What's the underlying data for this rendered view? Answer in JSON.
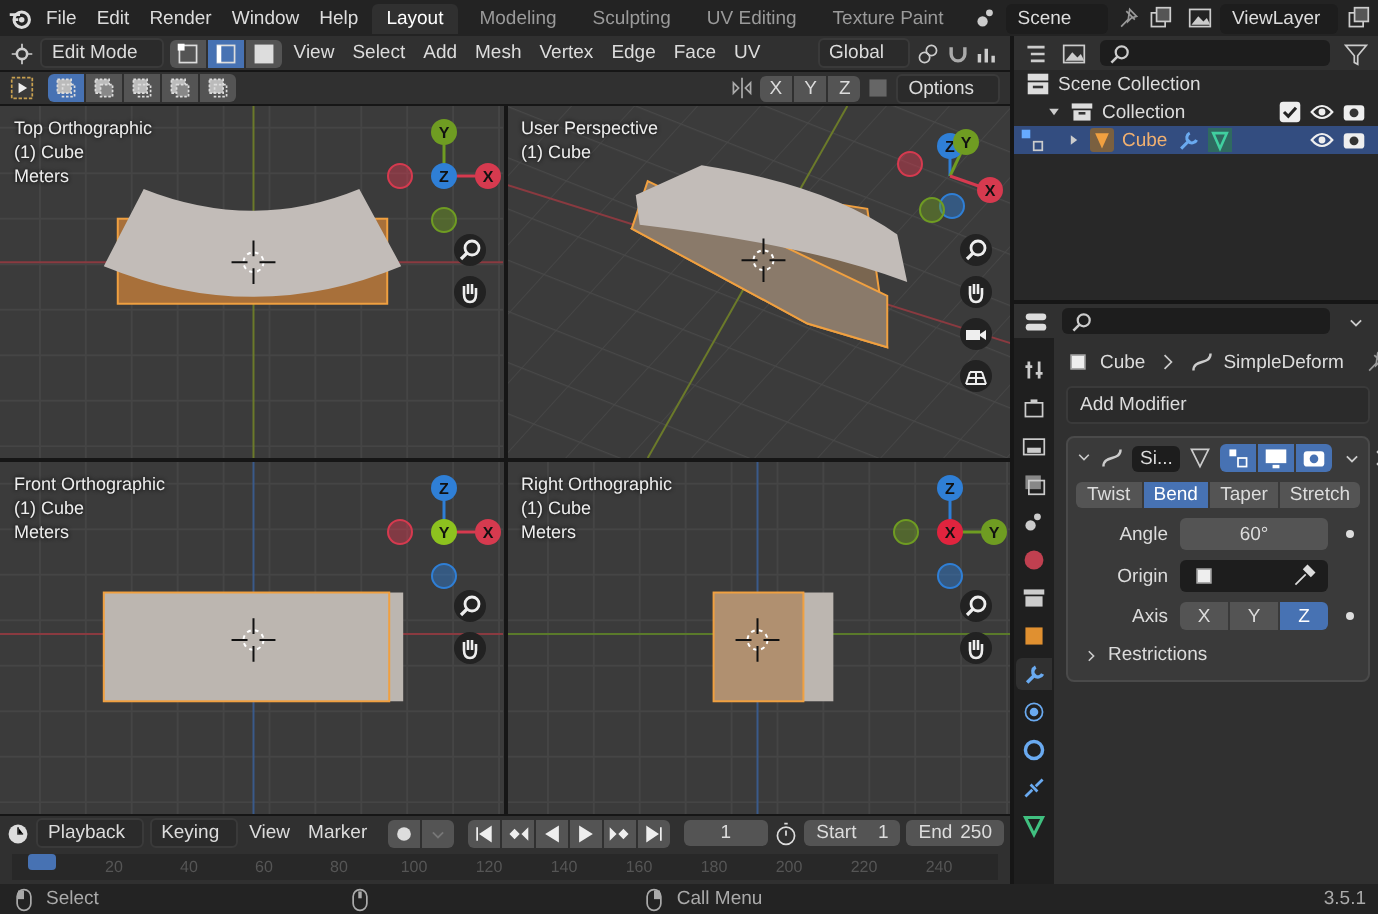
{
  "menus": [
    "File",
    "Edit",
    "Render",
    "Window",
    "Help"
  ],
  "workspaces": [
    {
      "label": "Layout",
      "selected": true
    },
    {
      "label": "Modeling",
      "selected": false
    },
    {
      "label": "Sculpting",
      "selected": false
    },
    {
      "label": "UV Editing",
      "selected": false
    },
    {
      "label": "Texture Paint",
      "selected": false
    }
  ],
  "scene": "Scene",
  "view_layer": "ViewLayer",
  "header": {
    "mode": "Edit Mode",
    "select_modes": [
      {
        "kind": "vertex",
        "selected": false
      },
      {
        "kind": "edge",
        "selected": true
      },
      {
        "kind": "face",
        "selected": false
      }
    ],
    "menus": [
      "View",
      "Select",
      "Add",
      "Mesh",
      "Vertex",
      "Edge",
      "Face",
      "UV"
    ],
    "orientation": "Global"
  },
  "tool_header": {
    "select_modes": [
      {
        "selected": true
      },
      {
        "selected": false
      },
      {
        "selected": false
      },
      {
        "selected": false
      },
      {
        "selected": false
      }
    ],
    "mirror": [
      {
        "label": "X",
        "selected": false
      },
      {
        "label": "Y",
        "selected": false
      },
      {
        "label": "Z",
        "selected": false
      }
    ],
    "options": "Options"
  },
  "viewports": [
    {
      "title": "Top Orthographic",
      "object": "(1) Cube",
      "units": "Meters",
      "gizmo": [
        {
          "label": "Y",
          "color": "#6f9c22"
        },
        {
          "label": "Z",
          "color": "#2f7fd6"
        },
        {
          "label": "X",
          "color": "#d63a4f"
        }
      ]
    },
    {
      "title": "User Perspective",
      "object": "(1) Cube",
      "gizmo": [
        {
          "label": "Z",
          "color": "#2f7fd6"
        },
        {
          "label": "Y",
          "color": "#6f9c22"
        },
        {
          "label": "X",
          "color": "#d63a4f"
        }
      ]
    },
    {
      "title": "Front Orthographic",
      "object": "(1) Cube",
      "units": "Meters",
      "gizmo": [
        {
          "label": "Z",
          "color": "#2f7fd6"
        },
        {
          "label": "Y",
          "color": "#8dc21f"
        },
        {
          "label": "X",
          "color": "#d63a4f"
        }
      ]
    },
    {
      "title": "Right Orthographic",
      "object": "(1) Cube",
      "units": "Meters",
      "gizmo": [
        {
          "label": "Z",
          "color": "#2f7fd6"
        },
        {
          "label": "X",
          "color": "#e0243e"
        },
        {
          "label": "Y",
          "color": "#6f9c22"
        }
      ]
    }
  ],
  "outliner": {
    "items": [
      {
        "kind": "scene_collection",
        "label": "Scene Collection",
        "children": [
          {
            "kind": "collection",
            "label": "Collection",
            "expanded": true,
            "checked": true,
            "children": [
              {
                "kind": "mesh",
                "label": "Cube",
                "expanded": false,
                "selected": true
              }
            ]
          }
        ]
      }
    ]
  },
  "properties": {
    "tabs": [
      {
        "kind": "tool",
        "selected": false
      },
      {
        "kind": "render",
        "selected": false
      },
      {
        "kind": "output",
        "selected": false
      },
      {
        "kind": "view_layer",
        "selected": false
      },
      {
        "kind": "scene",
        "selected": false
      },
      {
        "kind": "world",
        "selected": false
      },
      {
        "kind": "collection",
        "selected": false
      },
      {
        "kind": "object",
        "selected": false
      },
      {
        "kind": "modifier",
        "selected": true
      },
      {
        "kind": "particles",
        "selected": false
      },
      {
        "kind": "physics",
        "selected": false
      },
      {
        "kind": "constraints",
        "selected": false
      },
      {
        "kind": "data",
        "selected": false
      }
    ],
    "object": "Cube",
    "modifier": "SimpleDeform",
    "add_modifier": "Add Modifier",
    "panel": {
      "name": "Si...",
      "modes": [
        {
          "label": "Twist",
          "selected": false
        },
        {
          "label": "Bend",
          "selected": true
        },
        {
          "label": "Taper",
          "selected": false
        },
        {
          "label": "Stretch",
          "selected": false
        }
      ],
      "angle_label": "Angle",
      "angle": "60°",
      "origin_label": "Origin",
      "axis_label": "Axis",
      "axes": [
        {
          "label": "X",
          "selected": false
        },
        {
          "label": "Y",
          "selected": false
        },
        {
          "label": "Z",
          "selected": true
        }
      ],
      "restrictions": "Restrictions",
      "restrictions_expanded": false
    }
  },
  "timeline": {
    "menus": [
      "Playback",
      "Keying",
      "View",
      "Marker"
    ],
    "frame": "1",
    "start_label": "Start",
    "start": "1",
    "end_label": "End",
    "end": "250",
    "ruler": [
      "20",
      "40",
      "60",
      "80",
      "100",
      "120",
      "140",
      "160",
      "180",
      "200",
      "220",
      "240"
    ]
  },
  "status_bar": {
    "select": "Select",
    "call_menu": "Call Menu",
    "version": "3.5.1"
  }
}
